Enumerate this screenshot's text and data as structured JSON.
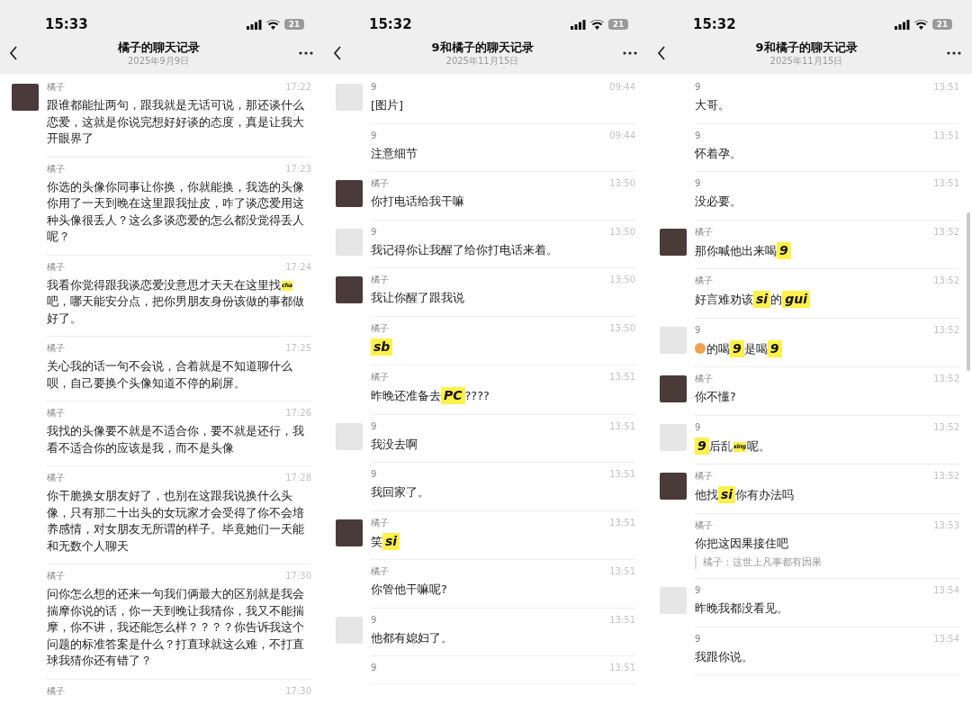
{
  "screens": [
    {
      "status_bar": {
        "time": "15:33",
        "battery": "21"
      },
      "nav": {
        "title": "橘子的聊天记录",
        "date": "2025年9月9日"
      },
      "scrollbar": false,
      "messages": [
        {
          "sender": "橘子",
          "color": "#4a3a3a",
          "time": "17:22",
          "parts": [
            {
              "kind": "text",
              "text": "跟谁都能扯两句，跟我就是无话可说，那还谈什么恋爱，这就是你说完想好好谈的态度，真是让我大开眼界了"
            }
          ]
        },
        {
          "sender": "橘子",
          "time": "17:23",
          "parts": [
            {
              "kind": "text",
              "text": "你选的头像你同事让你换，你就能换，我选的头像你用了一天到晚在这里跟我扯皮，咋了谈恋爱用这种头像很丢人？这么多谈恋爱的怎么都没觉得丢人呢？"
            }
          ]
        },
        {
          "sender": "橘子",
          "time": "17:24",
          "parts": [
            {
              "kind": "text",
              "text": "我看你觉得跟我谈恋爱没意思才天天在这里找"
            },
            {
              "kind": "mini",
              "text": "cha"
            },
            {
              "kind": "text",
              "text": "吧，哪天能安分点，把你男朋友身份该做的事都做好了。"
            }
          ]
        },
        {
          "sender": "橘子",
          "time": "17:25",
          "parts": [
            {
              "kind": "text",
              "text": "关心我的话一句不会说，合着就是不知道聊什么呗，自己要换个头像知道不停的刷屏。"
            }
          ]
        },
        {
          "sender": "橘子",
          "time": "17:26",
          "parts": [
            {
              "kind": "text",
              "text": "我找的头像要不就是不适合你，要不就是还行，我看不适合你的应该是我，而不是头像"
            }
          ]
        },
        {
          "sender": "橘子",
          "time": "17:28",
          "parts": [
            {
              "kind": "text",
              "text": "你干脆换女朋友好了，也别在这跟我说换什么头像，只有那二十出头的女玩家才会受得了你不会培养感情，对女朋友无所谓的样子。毕竟她们一天能和无数个人聊天"
            }
          ]
        },
        {
          "sender": "橘子",
          "time": "17:30",
          "parts": [
            {
              "kind": "text",
              "text": "问你怎么想的还来一句我们俩最大的区别就是我会揣摩你说的话，你一天到晚让我猜你，我又不能揣摩，你不讲，我还能怎么样？？？？你告诉我这个问题的标准答案是什么？打直球就这么难，不打直球我猜你还有错了？"
            }
          ]
        },
        {
          "sender": "橘子",
          "time": "17:30"
        }
      ]
    },
    {
      "status_bar": {
        "time": "15:32",
        "battery": "21"
      },
      "nav": {
        "title": "9和橘子的聊天记录",
        "date": "2025年11月15日"
      },
      "scrollbar": false,
      "messages": [
        {
          "sender": "9",
          "color": "#e6e6e6",
          "time": "09:44",
          "parts": [
            {
              "kind": "text",
              "text": "[图片]"
            }
          ]
        },
        {
          "sender": "9",
          "time": "09:44",
          "parts": [
            {
              "kind": "text",
              "text": "注意细节"
            }
          ]
        },
        {
          "sender": "橘子",
          "color": "#4a3a3a",
          "time": "13:50",
          "parts": [
            {
              "kind": "text",
              "text": "你打电话给我干嘛"
            }
          ]
        },
        {
          "sender": "9",
          "color": "#e6e6e6",
          "time": "13:50",
          "parts": [
            {
              "kind": "text",
              "text": "我记得你让我醒了给你打电话来着。"
            }
          ]
        },
        {
          "sender": "橘子",
          "color": "#4a3a3a",
          "time": "13:50",
          "parts": [
            {
              "kind": "text",
              "text": "我让你醒了跟我说"
            }
          ]
        },
        {
          "sender": "橘子",
          "time": "13:50",
          "parts": [
            {
              "kind": "sticker",
              "text": "sb"
            }
          ]
        },
        {
          "sender": "橘子",
          "time": "13:51",
          "parts": [
            {
              "kind": "text",
              "text": "昨晚还准备去"
            },
            {
              "kind": "sticker",
              "text": "PC"
            },
            {
              "kind": "text",
              "text": "????"
            }
          ]
        },
        {
          "sender": "9",
          "color": "#e6e6e6",
          "time": "13:51",
          "parts": [
            {
              "kind": "text",
              "text": "我没去啊"
            }
          ]
        },
        {
          "sender": "9",
          "time": "13:51",
          "parts": [
            {
              "kind": "text",
              "text": "我回家了。"
            }
          ]
        },
        {
          "sender": "橘子",
          "color": "#4a3a3a",
          "time": "13:51",
          "parts": [
            {
              "kind": "text",
              "text": "笑"
            },
            {
              "kind": "sticker",
              "text": "si"
            }
          ]
        },
        {
          "sender": "橘子",
          "time": "13:51",
          "parts": [
            {
              "kind": "text",
              "text": "你管他干嘛呢?"
            }
          ]
        },
        {
          "sender": "9",
          "color": "#e6e6e6",
          "time": "13:51",
          "parts": [
            {
              "kind": "text",
              "text": "他都有媳妇了。"
            }
          ]
        },
        {
          "sender": "9",
          "time": "13:51"
        }
      ]
    },
    {
      "status_bar": {
        "time": "15:32",
        "battery": "21"
      },
      "nav": {
        "title": "9和橘子的聊天记录",
        "date": "2025年11月15日"
      },
      "scrollbar": true,
      "messages": [
        {
          "sender": "9",
          "time": "13:51",
          "parts": [
            {
              "kind": "text",
              "text": "大哥。"
            }
          ]
        },
        {
          "sender": "9",
          "time": "13:51",
          "parts": [
            {
              "kind": "text",
              "text": "怀着孕。"
            }
          ]
        },
        {
          "sender": "9",
          "time": "13:51",
          "parts": [
            {
              "kind": "text",
              "text": "没必要。"
            }
          ]
        },
        {
          "sender": "橘子",
          "color": "#4a3a3a",
          "time": "13:52",
          "parts": [
            {
              "kind": "text",
              "text": "那你喊他出来喝"
            },
            {
              "kind": "sticker",
              "text": "9"
            }
          ]
        },
        {
          "sender": "橘子",
          "time": "13:52",
          "parts": [
            {
              "kind": "text",
              "text": "好言难劝该"
            },
            {
              "kind": "sticker",
              "text": "si"
            },
            {
              "kind": "text",
              "text": "的"
            },
            {
              "kind": "sticker",
              "text": "gui"
            }
          ]
        },
        {
          "sender": "9",
          "color": "#e6e6e6",
          "time": "13:52",
          "parts": [
            {
              "kind": "emoji"
            },
            {
              "kind": "text",
              "text": "的喝"
            },
            {
              "kind": "sticker",
              "text": "9"
            },
            {
              "kind": "text",
              "text": "是喝"
            },
            {
              "kind": "sticker",
              "text": "9"
            }
          ]
        },
        {
          "sender": "橘子",
          "color": "#4a3a3a",
          "time": "13:52",
          "parts": [
            {
              "kind": "text",
              "text": "你不懂?"
            }
          ]
        },
        {
          "sender": "9",
          "color": "#e6e6e6",
          "time": "13:52",
          "parts": [
            {
              "kind": "sticker",
              "text": "9"
            },
            {
              "kind": "text",
              "text": "后乱"
            },
            {
              "kind": "mini",
              "text": "xing"
            },
            {
              "kind": "text",
              "text": "呢。"
            }
          ]
        },
        {
          "sender": "橘子",
          "color": "#4a3a3a",
          "time": "13:52",
          "parts": [
            {
              "kind": "text",
              "text": "他找"
            },
            {
              "kind": "sticker",
              "text": "si"
            },
            {
              "kind": "text",
              "text": "你有办法吗"
            }
          ]
        },
        {
          "sender": "橘子",
          "time": "13:53",
          "parts": [
            {
              "kind": "text",
              "text": "你把这因果接住吧"
            }
          ],
          "quote": "橘子：这世上凡事都有因果"
        },
        {
          "sender": "9",
          "color": "#e6e6e6",
          "time": "13:54",
          "parts": [
            {
              "kind": "text",
              "text": "昨晚我都没看见。"
            }
          ]
        },
        {
          "sender": "9",
          "time": "13:54",
          "parts": [
            {
              "kind": "text",
              "text": "我跟你说。"
            }
          ]
        }
      ]
    }
  ]
}
